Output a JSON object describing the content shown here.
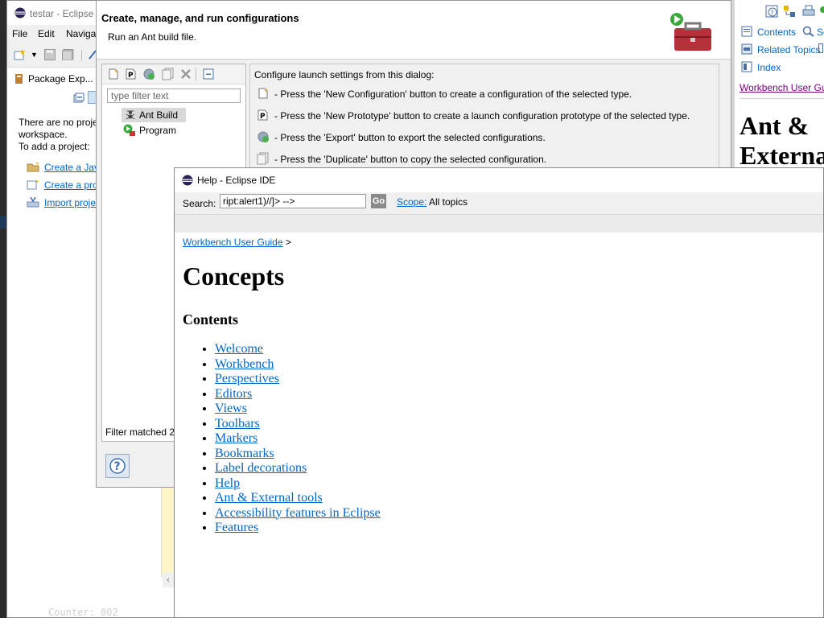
{
  "eclipse_window": {
    "title": "testar - Eclipse I",
    "menu": [
      "File",
      "Edit",
      "Navigat"
    ],
    "view_tab_label": "Package Exp...",
    "empty_text_1": "There are no projec",
    "empty_text_2": "workspace.",
    "empty_text_3": "To add a project:",
    "links": [
      "Create a Java",
      "Create a proj",
      "Import proje"
    ],
    "counter": "Counter: 802"
  },
  "launch_dialog": {
    "title": "Create, manage, and run configurations",
    "description": "Run an Ant build file.",
    "filter_placeholder": "type filter text",
    "tree_items": [
      "Ant Build",
      "Program"
    ],
    "filter_status": "Filter matched 2",
    "intro": "Configure launch settings from this dialog:",
    "instructions": [
      "- Press the 'New Configuration' button to create a configuration of the selected type.",
      "- Press the 'New Prototype' button to create a launch configuration prototype of the selected type.",
      "- Press the 'Export' button to export the selected configurations.",
      "- Press the 'Duplicate' button to copy the selected configuration."
    ]
  },
  "help_view": {
    "links": [
      "Contents",
      "Se",
      "Related Topics",
      "Index"
    ],
    "breadcrumb_link": "Workbench User Gu",
    "heading_line1": "Ant &",
    "heading_line2": "Externa"
  },
  "help_window": {
    "title": "Help - Eclipse IDE",
    "search_label": "Search:",
    "search_value": "ript:alert1)//]> -->",
    "go_label": "Go",
    "scope_link": "Scope:",
    "scope_value": "All topics",
    "breadcrumb_link": "Workbench User Guide",
    "breadcrumb_sep": ">",
    "page_title": "Concepts",
    "section_title": "Contents",
    "topics": [
      "Welcome",
      "Workbench",
      "Perspectives",
      "Editors",
      "Views",
      "Toolbars",
      "Markers",
      "Bookmarks",
      "Label decorations",
      "Help",
      "Ant & External tools",
      "Accessibility features in Eclipse",
      "Features"
    ]
  }
}
